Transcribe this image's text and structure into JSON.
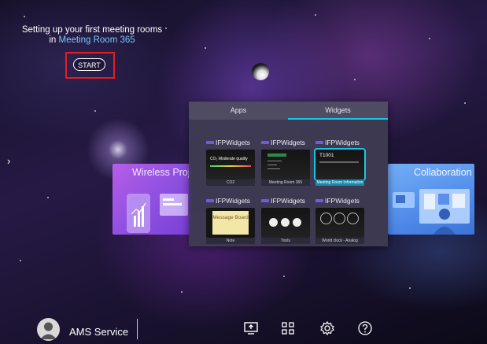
{
  "setup": {
    "line1": "Setting up your first meeting rooms",
    "line2_prefix": "in",
    "line2_room": "Meeting Room 365",
    "start_label": "START"
  },
  "cards": {
    "left_title": "Wireless Proje",
    "right_title": "Collaboration"
  },
  "panel": {
    "tabs": [
      {
        "label": "Apps",
        "active": false
      },
      {
        "label": "Widgets",
        "active": true
      }
    ],
    "tiles": [
      {
        "brand": "IFPWidgets",
        "caption": "CO2",
        "thumb_text": "CO₂  Moderate quality",
        "selected": false
      },
      {
        "brand": "IFPWidgets",
        "caption": "Meeting Room 365",
        "thumb_text": "",
        "selected": false
      },
      {
        "brand": "IFPWidgets",
        "caption": "Meeting Room Information",
        "thumb_text": "T1001",
        "selected": true
      },
      {
        "brand": "IFPWidgets",
        "caption": "Note",
        "thumb_text": "Message Board",
        "selected": false
      },
      {
        "brand": "IFPWidgets",
        "caption": "Tools",
        "thumb_text": "",
        "selected": false
      },
      {
        "brand": "IFPWidgets",
        "caption": "World clock - Analog",
        "thumb_text": "",
        "selected": false
      }
    ]
  },
  "bottom": {
    "user_name": "AMS Service",
    "icons": [
      "screen-share-icon",
      "apps-grid-icon",
      "settings-icon",
      "help-icon"
    ]
  },
  "colors": {
    "accent": "#19c6e6",
    "start_highlight": "#e02020",
    "room_link": "#7cc6ff"
  }
}
